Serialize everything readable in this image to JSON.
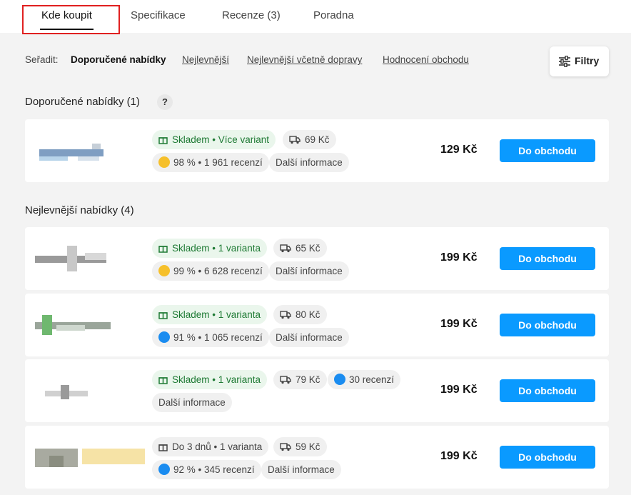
{
  "tabs": [
    {
      "label": "Kde koupit",
      "active": true
    },
    {
      "label": "Specifikace"
    },
    {
      "label": "Recenze (3)"
    },
    {
      "label": "Poradna"
    }
  ],
  "sort": {
    "label": "Seřadit:",
    "options": [
      "Doporučené nabídky",
      "Nejlevnější",
      "Nejlevnější včetně dopravy",
      "Hodnocení obchodu"
    ],
    "active": "Doporučené nabídky"
  },
  "filter_label": "Filtry",
  "sections": {
    "recommended_title": "Doporučené nabídky (1)",
    "recommended_help": "?",
    "cheapest_title": "Nejlevnější nabídky (4)"
  },
  "offers": [
    {
      "availability": "Skladem • Více variant",
      "shipping": "69 Kč",
      "rating": "98 % • 1 961 recenzí",
      "more": "Další informace",
      "price": "129 Kč",
      "button": "Do obchodu",
      "rating_color": "yellow",
      "in_stock": true
    },
    {
      "availability": "Skladem • 1 varianta",
      "shipping": "65 Kč",
      "rating": "99 % • 6 628 recenzí",
      "more": "Další informace",
      "price": "199 Kč",
      "button": "Do obchodu",
      "rating_color": "yellow",
      "in_stock": true
    },
    {
      "availability": "Skladem • 1 varianta",
      "shipping": "80 Kč",
      "rating": "91 % • 1 065 recenzí",
      "more": "Další informace",
      "price": "199 Kč",
      "button": "Do obchodu",
      "rating_color": "blue",
      "in_stock": true
    },
    {
      "availability": "Skladem • 1 varianta",
      "shipping": "79 Kč",
      "rating": "30 recenzí",
      "more": "Další informace",
      "price": "199 Kč",
      "button": "Do obchodu",
      "rating_color": "blue",
      "in_stock": true
    },
    {
      "availability": "Do 3 dnů • 1 varianta",
      "shipping": "59 Kč",
      "rating": "92 % • 345 recenzí",
      "more": "Další informace",
      "price": "199 Kč",
      "button": "Do obchodu",
      "rating_color": "blue",
      "in_stock": false
    }
  ],
  "colors": {
    "accent": "#0a9aff",
    "stock_green": "#1e7a34",
    "highlight_red": "#e02020"
  }
}
